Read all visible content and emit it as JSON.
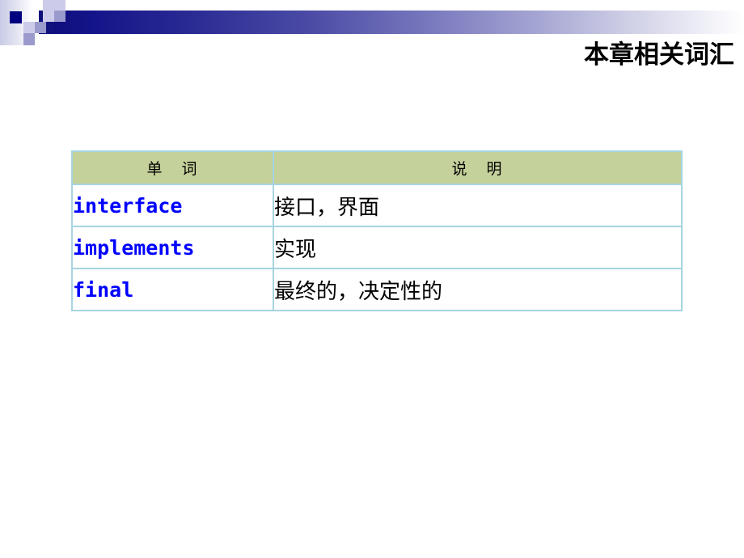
{
  "slide": {
    "title": "本章相关词汇",
    "background_color": "#ffffff"
  },
  "decoration": {
    "bar_gradient_start": "#0d0d7a",
    "bar_gradient_end": "#ffffff",
    "square_navy_dark": "#000080",
    "square_navy": "#12127f",
    "square_light": "#ccccea",
    "square_mid": "#9a9acd"
  },
  "vocab_table": {
    "border_color": "#a6d4e0",
    "header_background": "#c5d19a",
    "term_color": "#0000ff",
    "headers": {
      "term": "单 词",
      "description": "说 明"
    },
    "rows": [
      {
        "term": "interface",
        "description": "接口，界面"
      },
      {
        "term": "implements",
        "description": "实现"
      },
      {
        "term": "final",
        "description": "最终的，决定性的"
      }
    ]
  }
}
